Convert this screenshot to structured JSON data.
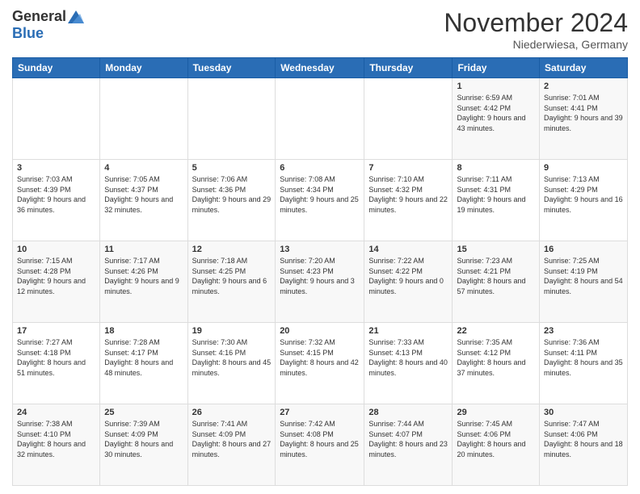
{
  "header": {
    "logo_general": "General",
    "logo_blue": "Blue",
    "title": "November 2024",
    "location": "Niederwiesa, Germany"
  },
  "days_of_week": [
    "Sunday",
    "Monday",
    "Tuesday",
    "Wednesday",
    "Thursday",
    "Friday",
    "Saturday"
  ],
  "weeks": [
    [
      {
        "day": "",
        "info": ""
      },
      {
        "day": "",
        "info": ""
      },
      {
        "day": "",
        "info": ""
      },
      {
        "day": "",
        "info": ""
      },
      {
        "day": "",
        "info": ""
      },
      {
        "day": "1",
        "info": "Sunrise: 6:59 AM\nSunset: 4:42 PM\nDaylight: 9 hours and 43 minutes."
      },
      {
        "day": "2",
        "info": "Sunrise: 7:01 AM\nSunset: 4:41 PM\nDaylight: 9 hours and 39 minutes."
      }
    ],
    [
      {
        "day": "3",
        "info": "Sunrise: 7:03 AM\nSunset: 4:39 PM\nDaylight: 9 hours and 36 minutes."
      },
      {
        "day": "4",
        "info": "Sunrise: 7:05 AM\nSunset: 4:37 PM\nDaylight: 9 hours and 32 minutes."
      },
      {
        "day": "5",
        "info": "Sunrise: 7:06 AM\nSunset: 4:36 PM\nDaylight: 9 hours and 29 minutes."
      },
      {
        "day": "6",
        "info": "Sunrise: 7:08 AM\nSunset: 4:34 PM\nDaylight: 9 hours and 25 minutes."
      },
      {
        "day": "7",
        "info": "Sunrise: 7:10 AM\nSunset: 4:32 PM\nDaylight: 9 hours and 22 minutes."
      },
      {
        "day": "8",
        "info": "Sunrise: 7:11 AM\nSunset: 4:31 PM\nDaylight: 9 hours and 19 minutes."
      },
      {
        "day": "9",
        "info": "Sunrise: 7:13 AM\nSunset: 4:29 PM\nDaylight: 9 hours and 16 minutes."
      }
    ],
    [
      {
        "day": "10",
        "info": "Sunrise: 7:15 AM\nSunset: 4:28 PM\nDaylight: 9 hours and 12 minutes."
      },
      {
        "day": "11",
        "info": "Sunrise: 7:17 AM\nSunset: 4:26 PM\nDaylight: 9 hours and 9 minutes."
      },
      {
        "day": "12",
        "info": "Sunrise: 7:18 AM\nSunset: 4:25 PM\nDaylight: 9 hours and 6 minutes."
      },
      {
        "day": "13",
        "info": "Sunrise: 7:20 AM\nSunset: 4:23 PM\nDaylight: 9 hours and 3 minutes."
      },
      {
        "day": "14",
        "info": "Sunrise: 7:22 AM\nSunset: 4:22 PM\nDaylight: 9 hours and 0 minutes."
      },
      {
        "day": "15",
        "info": "Sunrise: 7:23 AM\nSunset: 4:21 PM\nDaylight: 8 hours and 57 minutes."
      },
      {
        "day": "16",
        "info": "Sunrise: 7:25 AM\nSunset: 4:19 PM\nDaylight: 8 hours and 54 minutes."
      }
    ],
    [
      {
        "day": "17",
        "info": "Sunrise: 7:27 AM\nSunset: 4:18 PM\nDaylight: 8 hours and 51 minutes."
      },
      {
        "day": "18",
        "info": "Sunrise: 7:28 AM\nSunset: 4:17 PM\nDaylight: 8 hours and 48 minutes."
      },
      {
        "day": "19",
        "info": "Sunrise: 7:30 AM\nSunset: 4:16 PM\nDaylight: 8 hours and 45 minutes."
      },
      {
        "day": "20",
        "info": "Sunrise: 7:32 AM\nSunset: 4:15 PM\nDaylight: 8 hours and 42 minutes."
      },
      {
        "day": "21",
        "info": "Sunrise: 7:33 AM\nSunset: 4:13 PM\nDaylight: 8 hours and 40 minutes."
      },
      {
        "day": "22",
        "info": "Sunrise: 7:35 AM\nSunset: 4:12 PM\nDaylight: 8 hours and 37 minutes."
      },
      {
        "day": "23",
        "info": "Sunrise: 7:36 AM\nSunset: 4:11 PM\nDaylight: 8 hours and 35 minutes."
      }
    ],
    [
      {
        "day": "24",
        "info": "Sunrise: 7:38 AM\nSunset: 4:10 PM\nDaylight: 8 hours and 32 minutes."
      },
      {
        "day": "25",
        "info": "Sunrise: 7:39 AM\nSunset: 4:09 PM\nDaylight: 8 hours and 30 minutes."
      },
      {
        "day": "26",
        "info": "Sunrise: 7:41 AM\nSunset: 4:09 PM\nDaylight: 8 hours and 27 minutes."
      },
      {
        "day": "27",
        "info": "Sunrise: 7:42 AM\nSunset: 4:08 PM\nDaylight: 8 hours and 25 minutes."
      },
      {
        "day": "28",
        "info": "Sunrise: 7:44 AM\nSunset: 4:07 PM\nDaylight: 8 hours and 23 minutes."
      },
      {
        "day": "29",
        "info": "Sunrise: 7:45 AM\nSunset: 4:06 PM\nDaylight: 8 hours and 20 minutes."
      },
      {
        "day": "30",
        "info": "Sunrise: 7:47 AM\nSunset: 4:06 PM\nDaylight: 8 hours and 18 minutes."
      }
    ]
  ]
}
